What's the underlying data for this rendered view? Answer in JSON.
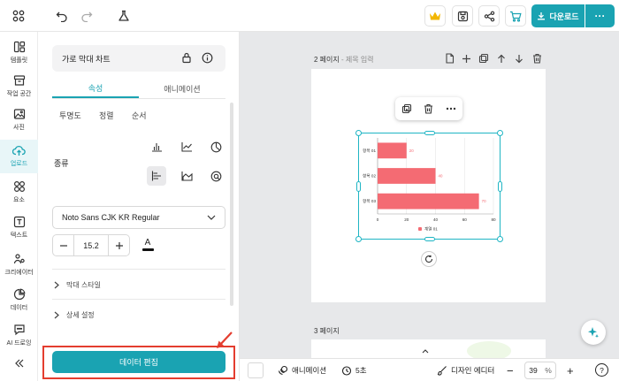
{
  "colors": {
    "accent": "#1aa3b2",
    "bar": "#f46b73",
    "highlight": "#e43d2f",
    "crown": "#f2b600"
  },
  "nav": {
    "items": [
      {
        "label": "템플릿",
        "icon": "template-icon"
      },
      {
        "label": "작업 공간",
        "icon": "workspace-icon"
      },
      {
        "label": "사진",
        "icon": "photo-icon"
      },
      {
        "label": "업로드",
        "icon": "upload-icon"
      },
      {
        "label": "요소",
        "icon": "elements-icon"
      },
      {
        "label": "텍스트",
        "icon": "text-icon"
      },
      {
        "label": "크리에이터",
        "icon": "creator-icon"
      },
      {
        "label": "데이터",
        "icon": "data-icon"
      },
      {
        "label": "AI 드로잉",
        "icon": "ai-drawing-icon"
      }
    ]
  },
  "topbar": {
    "download_label": "다운로드",
    "more_label": "···"
  },
  "panel": {
    "element_title": "가로 막대 차트",
    "tabs": [
      "속성",
      "애니메이션"
    ],
    "subtabs": [
      "투명도",
      "정렬",
      "순서"
    ],
    "type_label": "종류",
    "font": "Noto Sans CJK KR Regular",
    "font_size": "15.2",
    "color_label": "A",
    "sections": [
      "막대 스타일",
      "상세 설정"
    ],
    "edit_data_label": "데이터 편집"
  },
  "canvas": {
    "page2_label": "2 페이지",
    "page2_sub": " - 제목 입력",
    "page3_label": "3 페이지"
  },
  "chart_data": {
    "type": "bar",
    "orientation": "horizontal",
    "categories": [
      "항목 01",
      "항목 02",
      "항목 03"
    ],
    "series": [
      {
        "name": "계열 01",
        "values": [
          20,
          40,
          70
        ]
      }
    ],
    "data_labels": [
      "20",
      "40",
      "70"
    ],
    "xlim": [
      0,
      80
    ],
    "xticks": [
      "0",
      "20",
      "40",
      "60",
      "80"
    ],
    "grid": true,
    "legend": "bottom"
  },
  "bottombar": {
    "animation_label": "애니메이션",
    "duration": "5초",
    "editor_label": "디자인 에디터",
    "zoom": "39",
    "zoom_unit": "%",
    "minus": "−",
    "plus": "+",
    "help": "?"
  }
}
